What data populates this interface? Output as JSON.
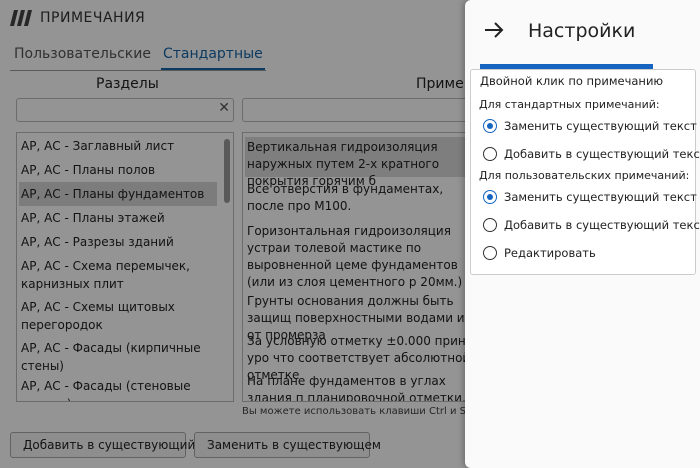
{
  "window": {
    "title": "ПРИМЕЧАНИЯ",
    "logo_icon": "app-logo-icon"
  },
  "tabs": [
    {
      "label": "Пользовательские",
      "active": false
    },
    {
      "label": "Стандартные",
      "active": true
    }
  ],
  "sections": {
    "header": "Разделы",
    "search_value": "",
    "clear_glyph": "✕",
    "items": [
      {
        "label": "АР, АС - Заглавный лист"
      },
      {
        "label": "АР, АС - Планы полов"
      },
      {
        "label": "АР, АС - Планы фундаментов",
        "selected": true
      },
      {
        "label": "АР, АС - Планы этажей"
      },
      {
        "label": "АР, АС - Разрезы зданий"
      },
      {
        "label": "АР, АС - Схема перемычек, карнизных плит"
      },
      {
        "label": "АР, АС - Схемы щитовых перегородок"
      },
      {
        "label": "АР, АС - Фасады (кирпичные стены)"
      },
      {
        "label": "АР, АС - Фасады (стеновые панели)"
      }
    ]
  },
  "notes": {
    "header": "Приме",
    "search_value": "",
    "items": [
      {
        "text": "Вертикальная гидроизоляция наружных путем 2-х кратного покрытия горячим б"
      },
      {
        "text": "Все отверстия в фундаментах, после про М100."
      },
      {
        "text": "Горизонтальная гидроизоляция устраи толевой мастике по выровненной цеме фундаментов (или из слоя цементного р 20мм.)"
      },
      {
        "text": "Грунты основания должны быть защищ поверхностными водами и от промерза"
      },
      {
        "text": "За условную отметку ±0.000 принят уро что соответствует абсолютной отметке"
      },
      {
        "text": "На плане фундаментов в углах здания п планировочной отметки, в знаменателе"
      }
    ],
    "hint": "Вы можете использовать клавиши Ctrl и Shift для"
  },
  "buttons": {
    "add": "Добавить в существующий",
    "replace": "Заменить в существующем"
  },
  "settings": {
    "title": "Настройки",
    "back_icon": "arrow-right-icon",
    "accent_color": "#1565c0",
    "card_caption": "Двойной клик по примечанию",
    "standard_group": {
      "caption": "Для стандартных примечаний:",
      "options": [
        {
          "label": "Заменить существующий текст",
          "checked": true
        },
        {
          "label": "Добавить в существующий текст",
          "checked": false
        }
      ]
    },
    "custom_group": {
      "caption": "Для пользовательских примечаний:",
      "options": [
        {
          "label": "Заменить существующий текст",
          "checked": true
        },
        {
          "label": "Добавить в существующий текст",
          "checked": false
        },
        {
          "label": "Редактировать",
          "checked": false
        }
      ]
    }
  }
}
